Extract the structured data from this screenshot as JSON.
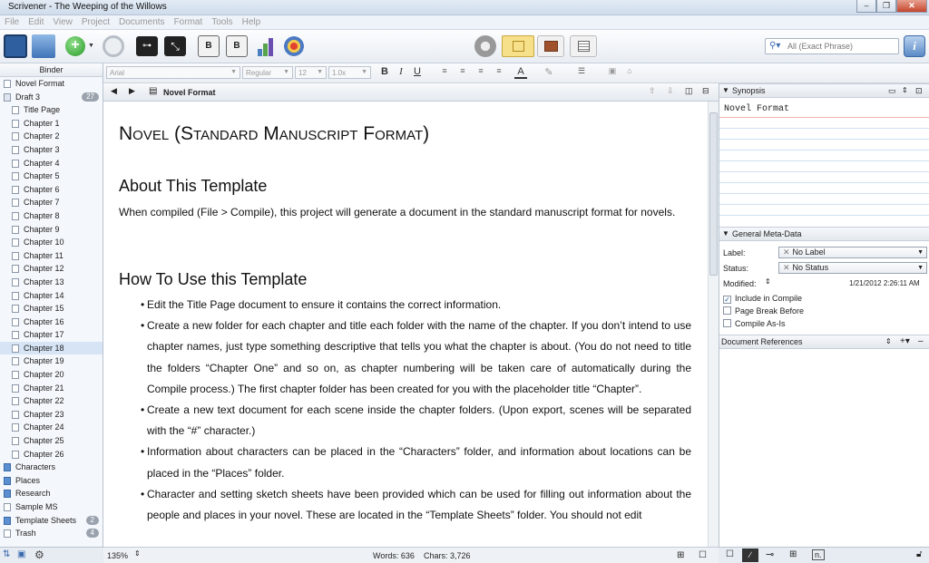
{
  "window": {
    "title": "Scrivener - The Weeping of the Willows"
  },
  "menu": [
    "File",
    "Edit",
    "View",
    "Project",
    "Documents",
    "Format",
    "Tools",
    "Help"
  ],
  "search": {
    "placeholder": "All (Exact Phrase)"
  },
  "binder": {
    "header": "Binder",
    "items": [
      {
        "label": "Novel Format",
        "type": "doc",
        "indent": 0
      },
      {
        "label": "Draft 3",
        "type": "draft",
        "indent": 0,
        "count": "27"
      },
      {
        "label": "Title Page",
        "type": "doc",
        "indent": 1
      },
      {
        "label": "Chapter 1",
        "type": "doc",
        "indent": 1
      },
      {
        "label": "Chapter 2",
        "type": "doc",
        "indent": 1
      },
      {
        "label": "Chapter 3",
        "type": "doc",
        "indent": 1
      },
      {
        "label": "Chapter 4",
        "type": "doc",
        "indent": 1
      },
      {
        "label": "Chapter 5",
        "type": "doc",
        "indent": 1
      },
      {
        "label": "Chapter 6",
        "type": "doc",
        "indent": 1
      },
      {
        "label": "Chapter 7",
        "type": "doc",
        "indent": 1
      },
      {
        "label": "Chapter 8",
        "type": "doc",
        "indent": 1
      },
      {
        "label": "Chapter 9",
        "type": "doc",
        "indent": 1
      },
      {
        "label": "Chapter 10",
        "type": "doc",
        "indent": 1
      },
      {
        "label": "Chapter 11",
        "type": "doc",
        "indent": 1
      },
      {
        "label": "Chapter 12",
        "type": "doc",
        "indent": 1
      },
      {
        "label": "Chapter 13",
        "type": "doc",
        "indent": 1
      },
      {
        "label": "Chapter 14",
        "type": "doc",
        "indent": 1
      },
      {
        "label": "Chapter 15",
        "type": "doc",
        "indent": 1
      },
      {
        "label": "Chapter 16",
        "type": "doc",
        "indent": 1
      },
      {
        "label": "Chapter 17",
        "type": "doc",
        "indent": 1
      },
      {
        "label": "Chapter 18",
        "type": "doc",
        "indent": 1,
        "selected": true
      },
      {
        "label": "Chapter 19",
        "type": "doc",
        "indent": 1
      },
      {
        "label": "Chapter 20",
        "type": "doc",
        "indent": 1
      },
      {
        "label": "Chapter 21",
        "type": "doc",
        "indent": 1
      },
      {
        "label": "Chapter 22",
        "type": "doc",
        "indent": 1
      },
      {
        "label": "Chapter 23",
        "type": "doc",
        "indent": 1
      },
      {
        "label": "Chapter 24",
        "type": "doc",
        "indent": 1
      },
      {
        "label": "Chapter 25",
        "type": "doc",
        "indent": 1
      },
      {
        "label": "Chapter 26",
        "type": "doc",
        "indent": 1
      },
      {
        "label": "Characters",
        "type": "folder",
        "indent": 0
      },
      {
        "label": "Places",
        "type": "folder",
        "indent": 0
      },
      {
        "label": "Research",
        "type": "folder",
        "indent": 0
      },
      {
        "label": "Sample MS",
        "type": "doc",
        "indent": 0
      },
      {
        "label": "Template Sheets",
        "type": "folder",
        "indent": 0,
        "count": "2"
      },
      {
        "label": "Trash",
        "type": "doc",
        "indent": 0,
        "count": "4"
      }
    ]
  },
  "format": {
    "font": "Arial",
    "style": "Regular",
    "size": "12",
    "spacing": "1.0x"
  },
  "editor": {
    "header_title": "Novel Format",
    "title": "Novel (Standard Manuscript Format)",
    "h_about": "About This Template",
    "p_about": "When compiled (File > Compile), this project will generate a document in the standard manuscript format for novels.",
    "h_howto": "How To Use this Template",
    "bullets": [
      "Edit the Title Page document to ensure it contains the correct information.",
      "Create a new folder for each chapter and title each folder with the name of the chapter. If you don’t intend to use chapter names, just type something descriptive that tells you what the chapter is about. (You do not need to title the folders “Chapter One” and so on, as chapter numbering will be taken care of automatically during the Compile process.) The first chapter folder has been created for you with the placeholder title “Chapter”.",
      "Create a new text document for each scene inside the chapter folders. (Upon export, scenes will be separated with the “#” character.)",
      "Information about characters can be placed in the “Characters” folder, and information about locations can be placed in the “Places” folder.",
      "Character and setting sketch sheets have been provided which can be used for filling out information about the people and places in your novel. These are located in the “Template Sheets” folder. You should not edit"
    ]
  },
  "status": {
    "zoom": "135%",
    "words": "Words: 636",
    "chars": "Chars: 3,726"
  },
  "inspector": {
    "synopsis_header": "Synopsis",
    "synopsis_text": "Novel Format",
    "meta_header": "General Meta-Data",
    "label_key": "Label:",
    "label_value": "No Label",
    "status_key": "Status:",
    "status_value": "No Status",
    "modified_key": "Modified:",
    "modified_value": "1/21/2012 2:26:11 AM",
    "include_compile": "Include in Compile",
    "page_break": "Page Break Before",
    "compile_as_is": "Compile As-Is",
    "refs_header": "Document References"
  }
}
